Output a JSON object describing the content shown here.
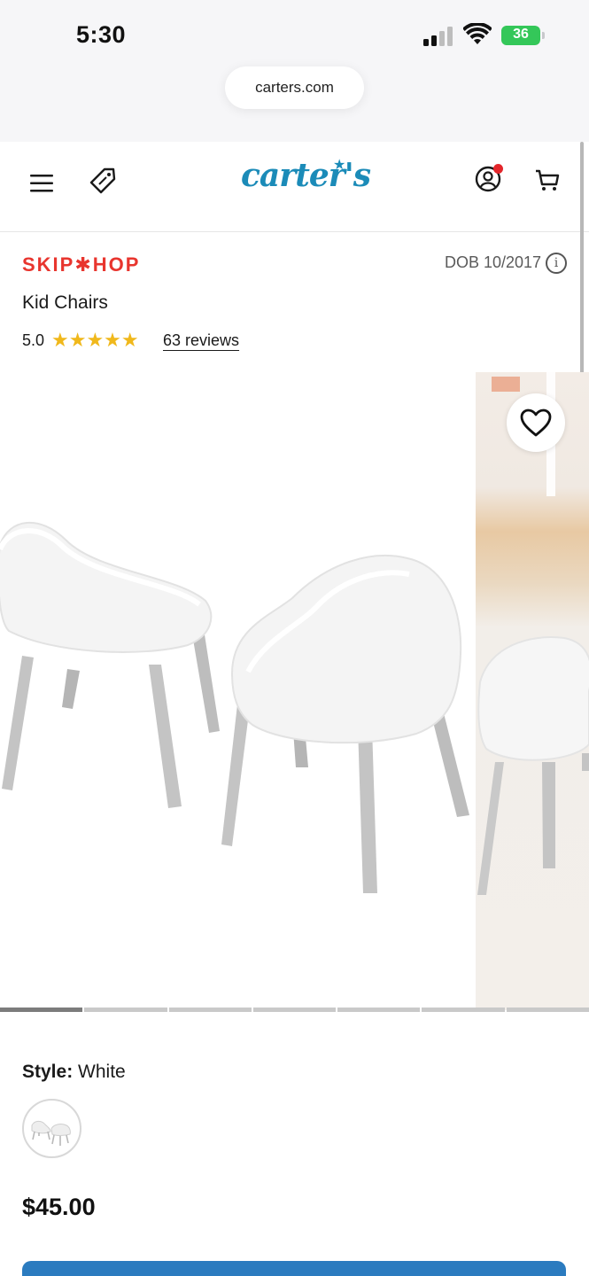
{
  "status_bar": {
    "time": "5:30",
    "battery_level": "36"
  },
  "browser": {
    "url": "carters.com"
  },
  "header": {
    "logo_text": "carter's"
  },
  "product": {
    "brand": "SKIP✱HOP",
    "dob": "DOB 10/2017",
    "title": "Kid Chairs",
    "rating": "5.0",
    "stars": "★★★★★",
    "reviews": "63 reviews",
    "style_label": "Style:",
    "style_value": "White",
    "price": "$45.00"
  },
  "carousel": {
    "slide_count": 7,
    "active_slide": 1
  },
  "colors": {
    "brand_red": "#e8352e",
    "logo_blue": "#1b8bb8",
    "star_gold": "#f0b81b",
    "cta_blue": "#2b7bbf"
  }
}
